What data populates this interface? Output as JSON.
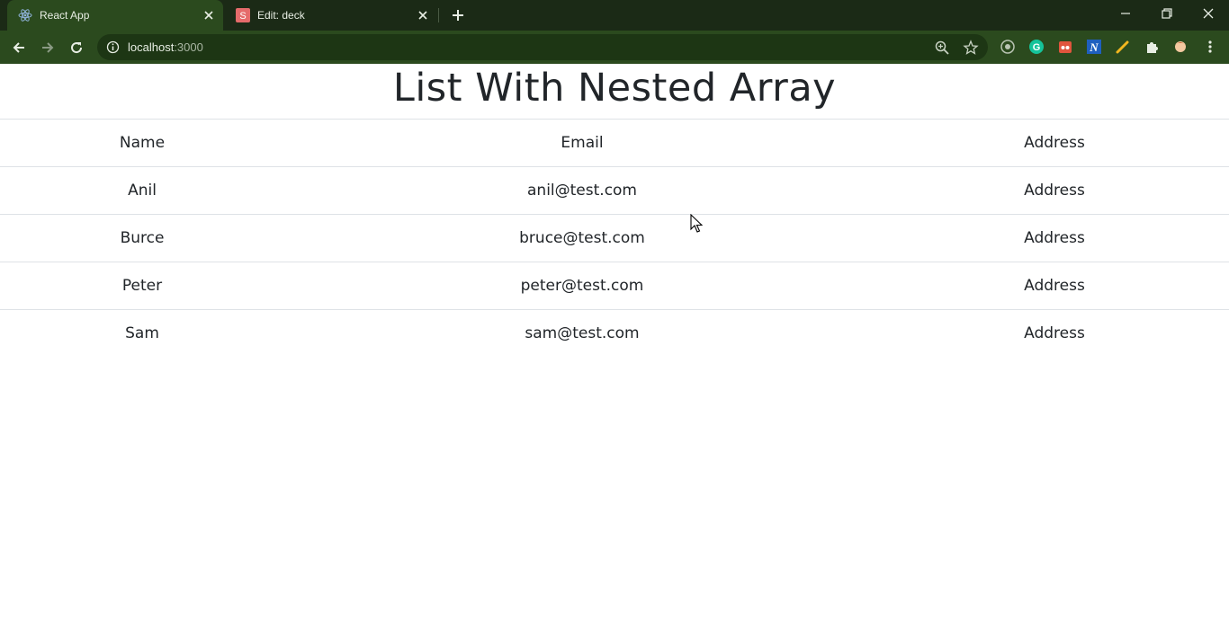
{
  "browser": {
    "tabs": [
      {
        "title": "React App",
        "icon": "react-icon",
        "active": true
      },
      {
        "title": "Edit: deck",
        "icon": "s-letter-icon",
        "active": false
      }
    ],
    "address": {
      "host": "localhost",
      "port": ":3000"
    },
    "colors": {
      "tabstrip": "#1b2a16",
      "toolbar": "#2b4a1e",
      "omnibox": "#1d3614"
    }
  },
  "page": {
    "title": "List With Nested Array",
    "table": {
      "headers": [
        "Name",
        "Email",
        "Address"
      ],
      "rows": [
        {
          "name": "Anil",
          "email": "anil@test.com",
          "address": "Address"
        },
        {
          "name": "Burce",
          "email": "bruce@test.com",
          "address": "Address"
        },
        {
          "name": "Peter",
          "email": "peter@test.com",
          "address": "Address"
        },
        {
          "name": "Sam",
          "email": "sam@test.com",
          "address": "Address"
        }
      ]
    }
  }
}
